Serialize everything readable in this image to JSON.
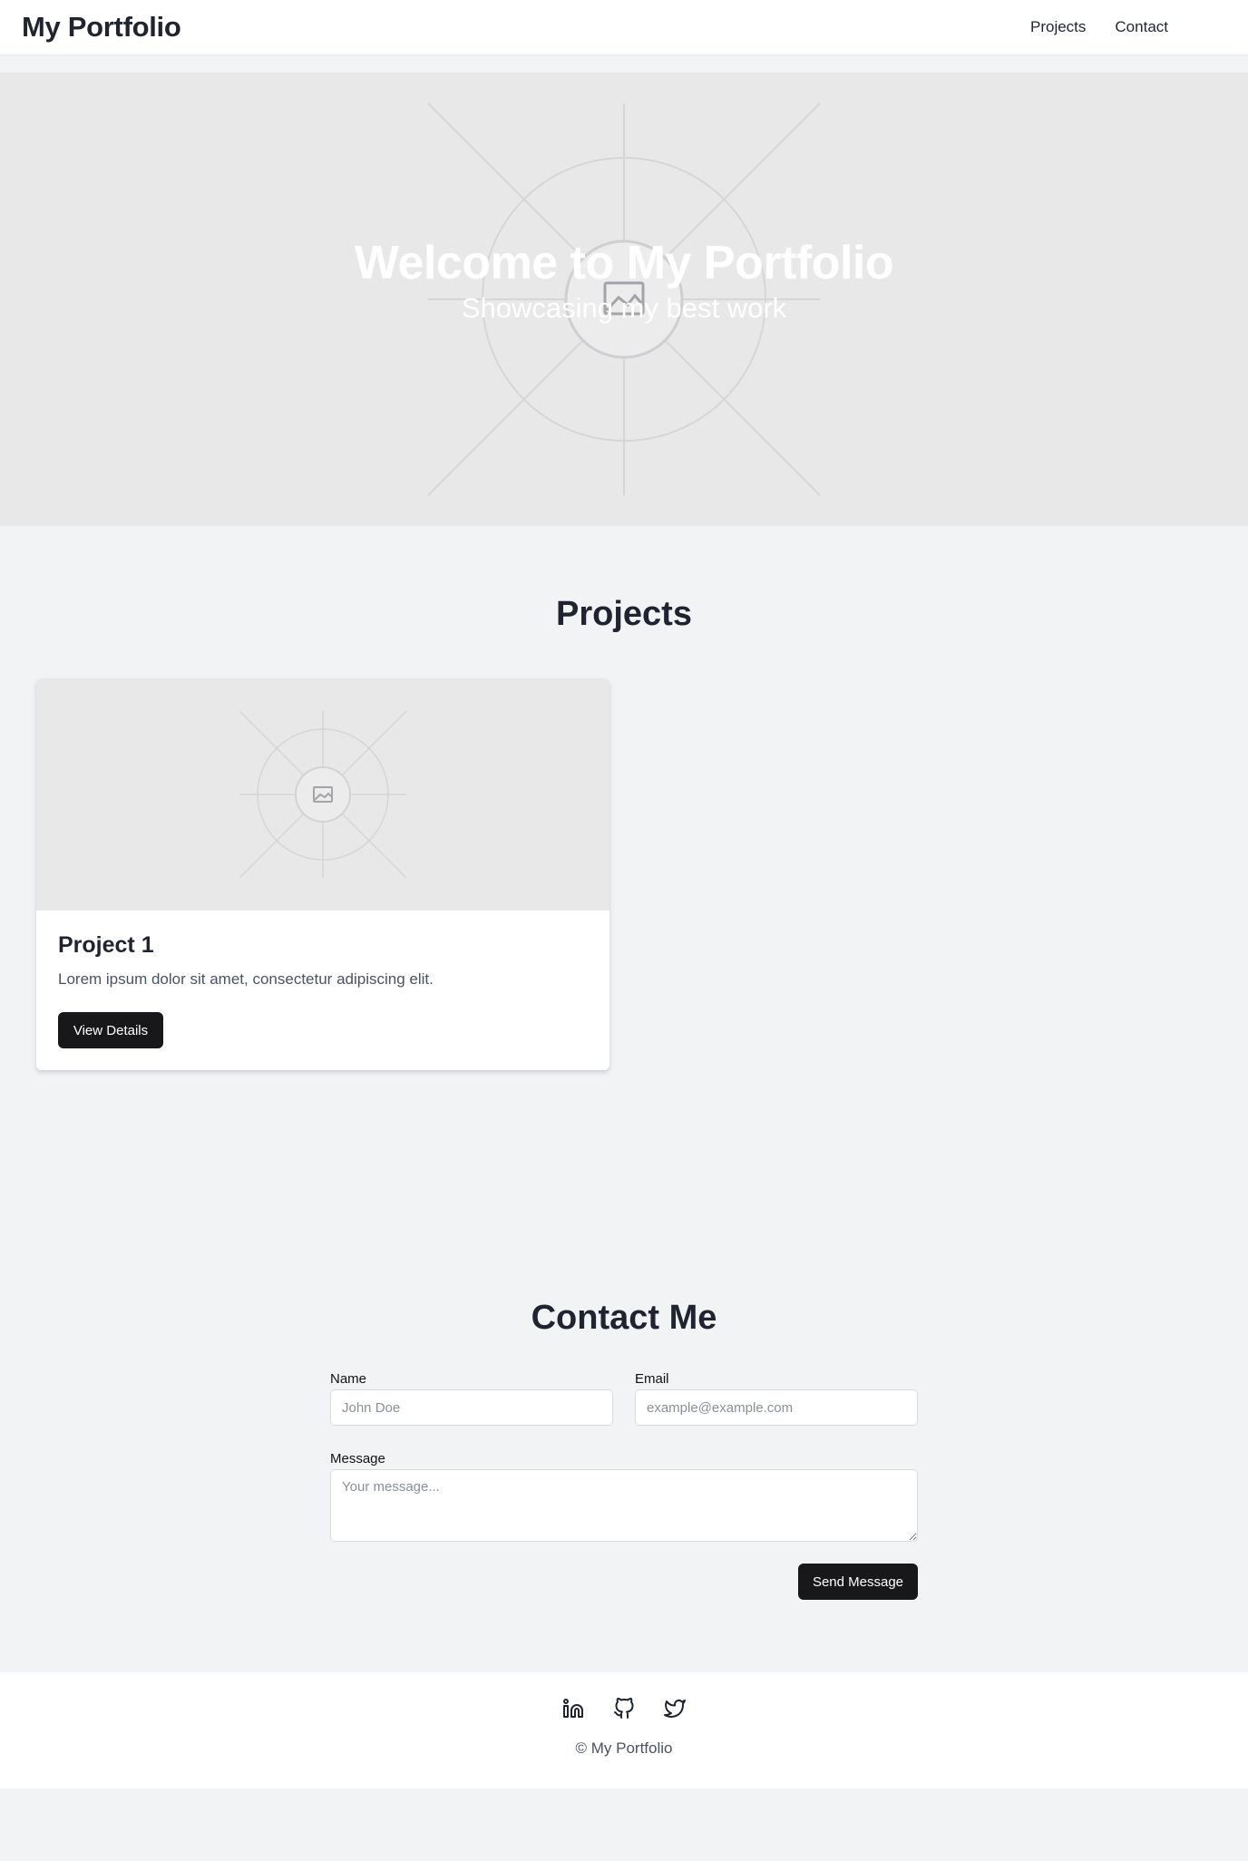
{
  "header": {
    "site_title": "My Portfolio",
    "nav": [
      "Projects",
      "Contact"
    ]
  },
  "hero": {
    "title": "Welcome to My Portfolio",
    "subtitle": "Showcasing my best work"
  },
  "projects": {
    "title": "Projects",
    "items": [
      {
        "title": "Project 1",
        "description": "Lorem ipsum dolor sit amet, consectetur adipiscing elit.",
        "button_label": "View Details"
      }
    ]
  },
  "contact": {
    "title": "Contact Me",
    "name_label": "Name",
    "name_placeholder": "John Doe",
    "email_label": "Email",
    "email_placeholder": "example@example.com",
    "message_label": "Message",
    "message_placeholder": "Your message...",
    "submit_label": "Send Message"
  },
  "footer": {
    "social_icons": [
      "linkedin-icon",
      "github-icon",
      "twitter-icon"
    ],
    "copyright": "© My Portfolio"
  },
  "colors": {
    "background": "#f2f3f5",
    "placeholder_fill": "#e8e8e9",
    "button": "#18181b",
    "heading": "#1f2430"
  }
}
